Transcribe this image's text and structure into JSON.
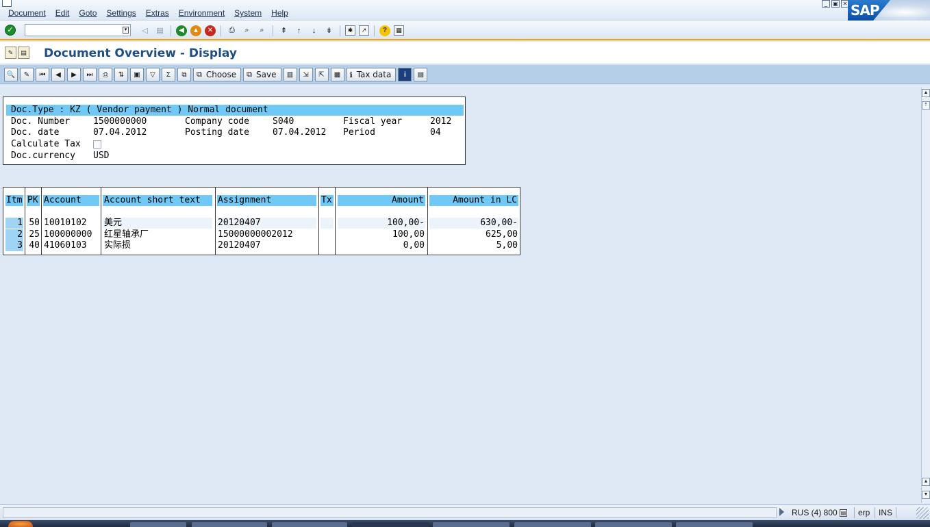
{
  "menu": {
    "items": [
      {
        "label": "Document"
      },
      {
        "label": "Edit"
      },
      {
        "label": "Goto"
      },
      {
        "label": "Settings"
      },
      {
        "label": "Extras"
      },
      {
        "label": "Environment"
      },
      {
        "label": "System"
      },
      {
        "label": "Help"
      }
    ]
  },
  "brand": {
    "logo_text": "SAP",
    "color": "#0d4fa4"
  },
  "command_field": {
    "value": ""
  },
  "title": {
    "text": "Document Overview - Display"
  },
  "app_toolbar": {
    "choose_label": "Choose",
    "save_label": "Save",
    "tax_data_label": "Tax data"
  },
  "header": {
    "doc_type_line": "Doc.Type : KZ ( Vendor payment ) Normal document",
    "doc_number_label": "Doc. Number",
    "doc_number": "1500000000",
    "company_code_label": "Company code",
    "company_code": "S040",
    "fiscal_year_label": "Fiscal year",
    "fiscal_year": "2012",
    "doc_date_label": "Doc. date",
    "doc_date": "07.04.2012",
    "posting_date_label": "Posting date",
    "posting_date": "07.04.2012",
    "period_label": "Period",
    "period": "04",
    "calculate_tax_label": "Calculate Tax",
    "calculate_tax_checked": false,
    "currency_label": "Doc.currency",
    "currency": "USD"
  },
  "items_table": {
    "columns": {
      "itm": "Itm",
      "pk": "PK",
      "account": "Account",
      "short_text": "Account short text",
      "assignment": "Assignment",
      "tx": "Tx",
      "amount": "Amount",
      "amount_lc": "Amount in LC"
    },
    "rows": [
      {
        "itm": "1",
        "pk": "50",
        "account": "10010102",
        "short_text": "美元",
        "assignment": "20120407",
        "tx": "",
        "amount": "100,00-",
        "amount_lc": "630,00-"
      },
      {
        "itm": "2",
        "pk": "25",
        "account": "100000000",
        "short_text": "红星轴承厂",
        "assignment": "15000000002012",
        "tx": "",
        "amount": "100,00",
        "amount_lc": "625,00"
      },
      {
        "itm": "3",
        "pk": "40",
        "account": "41060103",
        "short_text": "实际损",
        "assignment": "20120407",
        "tx": "",
        "amount": "0,00",
        "amount_lc": "5,00"
      }
    ]
  },
  "status_bar": {
    "system_info": "RUS (4) 800",
    "server": "erp",
    "mode": "INS"
  }
}
